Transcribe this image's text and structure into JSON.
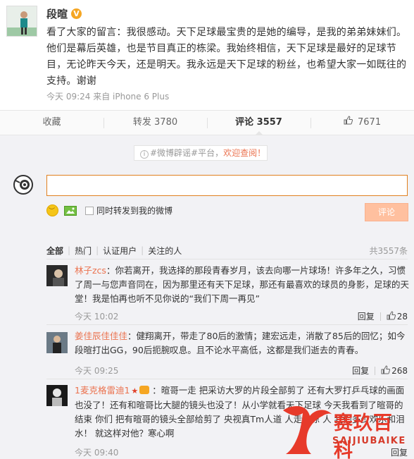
{
  "post": {
    "author": "段暄",
    "verified_badge": "V",
    "text": "看了大家的留言：我很感动。天下足球最宝贵的是她的编导，是我的弟弟妹妹们。他们是幕后英雄，也是节目真正的栋梁。我始终相信，天下足球是最好的足球节目，无论昨天今天，还是明天。我永远是天下足球的粉丝，也希望大家一如既往的支持。谢谢",
    "meta": "今天 09:24 来自 iPhone 6 Plus"
  },
  "actions": {
    "favorite": "收藏",
    "repost": "转发 3780",
    "comment": "评论 3557",
    "like": "7671"
  },
  "comment_box": {
    "notice_prefix": "#微博辟谣#平台，",
    "notice_link": "欢迎查阅！",
    "repost_option": "同时转发到我的微博",
    "submit": "评论"
  },
  "filters": {
    "items": [
      "全部",
      "热门",
      "认证用户",
      "关注的人"
    ],
    "total": "共3557条"
  },
  "comments": [
    {
      "user": "林子zcs",
      "text": "：你若离开，我选择的那段青春岁月，该去向哪一片球场！许多年之久，习惯了周一与您声音同在，因为那里还有天下足球，那还有最喜欢的球员的身影，足球的天堂！我是怕再也听不见你说的“我们下周一再见”",
      "time": "今天 10:02",
      "reply": "回复",
      "likes": "28"
    },
    {
      "user": "姜佳辰佳佳佳",
      "text": "：健翔离开，带走了80后的激情；建宏远走，消散了85后的回忆；如今段暄打出GG，90后扼腕叹息。且不论水平高低，这都是我们逝去的青春。",
      "time": "今天 09:25",
      "reply": "回复",
      "likes": "268"
    },
    {
      "user": "1麦克格雷迪1",
      "text": "：暄哥一走 把采访大罗的片段全部剪了 还有大罗打乒乓球的画面也没了！还有和暄哥比大腿的镜头也没了！从小学就看天下足球 今天我看到了暄哥的结束 你们 把有暄哥的镜头全部给剪了 央视真Tm人道 人走茶凉 人 我们多少欢乐和泪水！ 就这样对他？寒心啊",
      "time": "今天 09:40",
      "reply": "回复",
      "likes": ""
    }
  ],
  "watermark": {
    "title": "赛玖百科",
    "subtitle": "SAIJIUBAIKE"
  },
  "colors": {
    "accent": "#eb7350",
    "input_border": "#e0801f",
    "submit_bg": "#ffc09f",
    "watermark": "#e73a2a"
  }
}
